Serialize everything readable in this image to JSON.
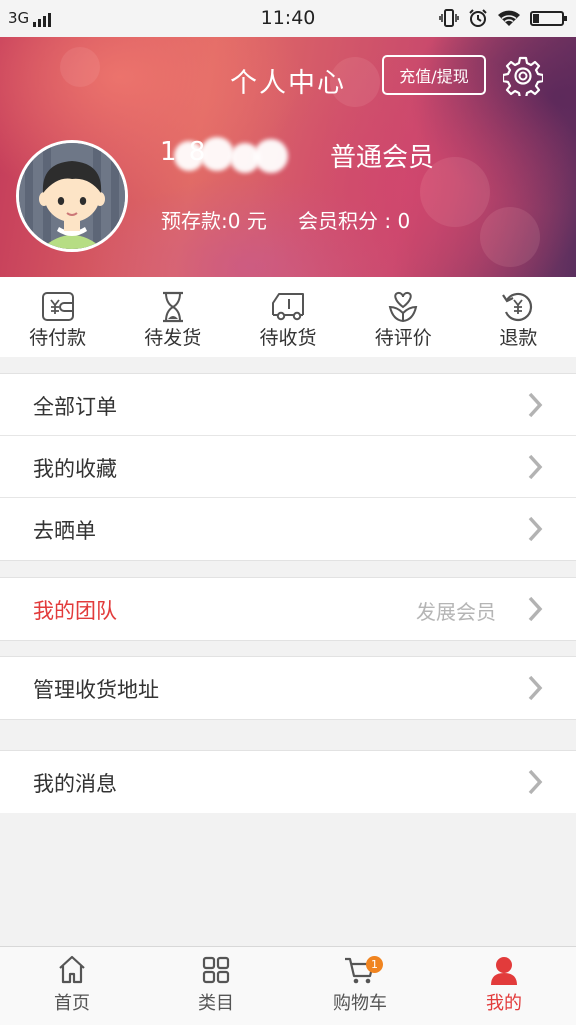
{
  "status_bar": {
    "network": "3G",
    "time": "11:40"
  },
  "header": {
    "title": "个人中心",
    "recharge_label": "充值/提现",
    "phone_visible": "1        8",
    "member_level": "普通会员",
    "balance": "预存款:0 元",
    "points": "会员积分 : 0"
  },
  "order_status": [
    {
      "label": "待付款",
      "icon": "wallet-yen-icon"
    },
    {
      "label": "待发货",
      "icon": "hourglass-icon"
    },
    {
      "label": "待收货",
      "icon": "truck-icon"
    },
    {
      "label": "待评价",
      "icon": "heart-flower-icon"
    },
    {
      "label": "退款",
      "icon": "refund-yen-icon"
    }
  ],
  "menu": {
    "all_orders": "全部订单",
    "favorites": "我的收藏",
    "share_order": "去晒单",
    "my_team": "我的团队",
    "my_team_action": "发展会员",
    "address": "管理收货地址",
    "messages": "我的消息"
  },
  "tabbar": {
    "home": "首页",
    "category": "类目",
    "cart": "购物车",
    "cart_badge": "1",
    "mine": "我的"
  },
  "colors": {
    "accent": "#e23b3b",
    "badge": "#f08420"
  }
}
